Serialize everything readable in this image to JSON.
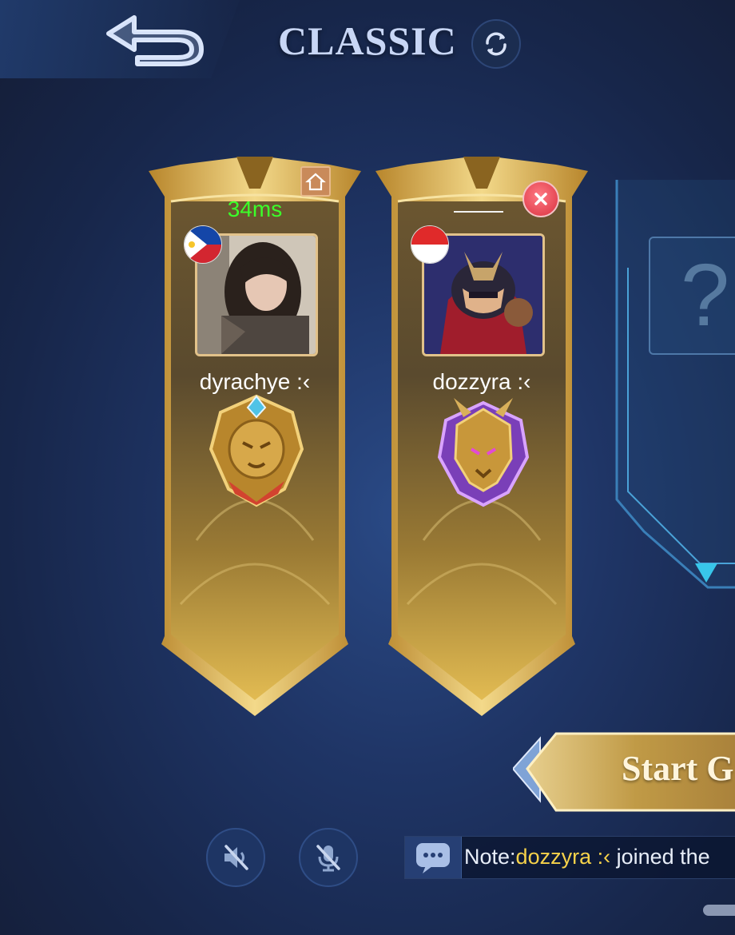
{
  "header": {
    "title": "CLASSIC"
  },
  "players": [
    {
      "name": "dyrachye :‹",
      "ping": "34ms",
      "flag": "philippines-flag-icon",
      "rank_icon": "gold-lion-rank-icon"
    },
    {
      "name": "dozzyra :‹",
      "ping": "",
      "flag": "indonesia-flag-icon",
      "rank_icon": "purple-dragon-rank-icon"
    }
  ],
  "empty_slot": {
    "symbol": "?"
  },
  "actions": {
    "start_label": "Start G"
  },
  "note": {
    "prefix": "Note:",
    "player": "dozzyra :‹",
    "suffix": " joined the"
  },
  "colors": {
    "ping": "#3cff2a",
    "note_name": "#f6d24a",
    "banner_gold": "#c89a3a"
  }
}
